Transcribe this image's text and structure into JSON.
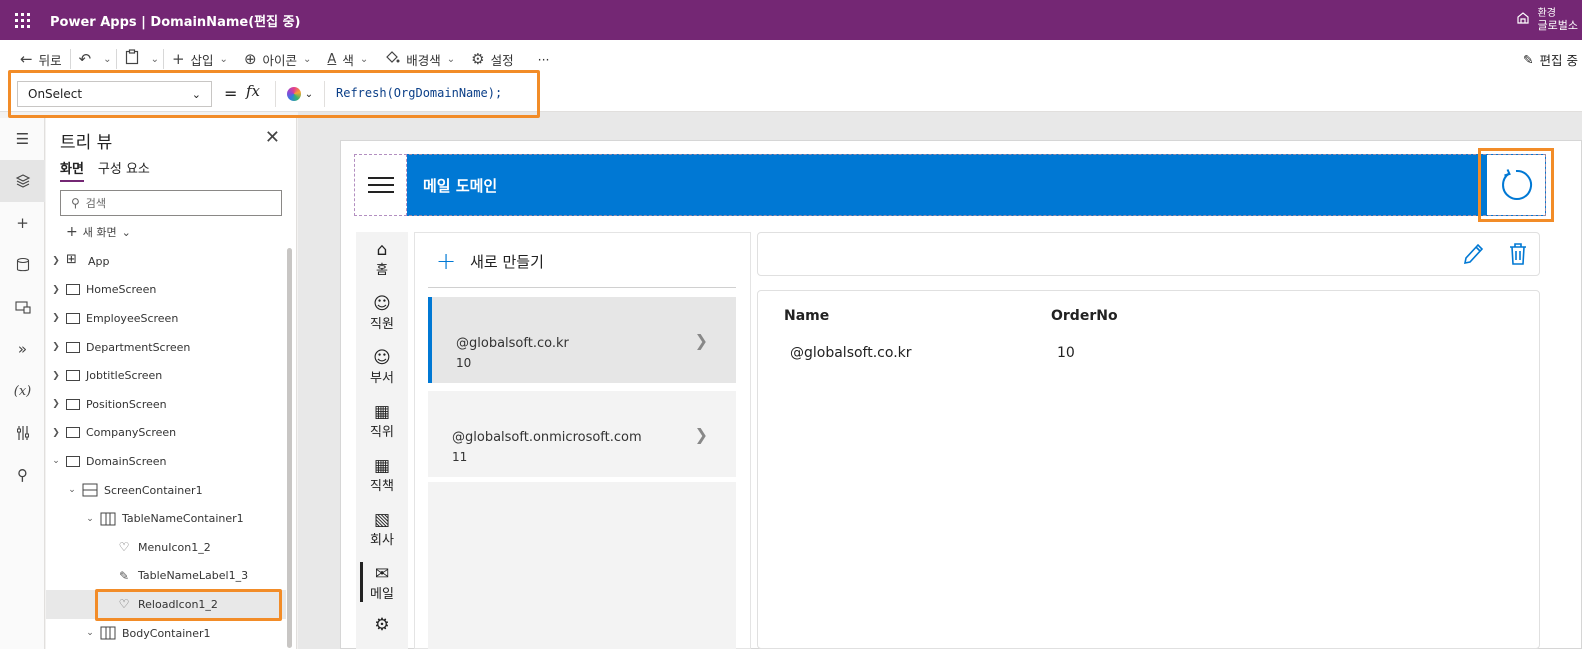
{
  "topbar": {
    "title": "Power Apps  |  DomainName(편집 중)",
    "env_label": "환경",
    "env_name": "글로벌소"
  },
  "commandbar": {
    "back": "뒤로",
    "insert": "삽입",
    "icon": "아이콘",
    "color": "색",
    "background": "배경색",
    "settings": "설정",
    "more": "···",
    "editing": "편집 중"
  },
  "formula": {
    "property": "OnSelect",
    "equals": "=",
    "fx": "fx",
    "expression": "Refresh(OrgDomainName);"
  },
  "tree": {
    "title": "트리 뷰",
    "tabs": [
      "화면",
      "구성 요소"
    ],
    "search_placeholder": "검색",
    "new_screen": "새 화면",
    "nodes": [
      {
        "label": "App"
      },
      {
        "label": "HomeScreen"
      },
      {
        "label": "EmployeeScreen"
      },
      {
        "label": "DepartmentScreen"
      },
      {
        "label": "JobtitleScreen"
      },
      {
        "label": "PositionScreen"
      },
      {
        "label": "CompanyScreen"
      },
      {
        "label": "DomainScreen"
      },
      {
        "label": "ScreenContainer1"
      },
      {
        "label": "TableNameContainer1"
      },
      {
        "label": "MenuIcon1_2"
      },
      {
        "label": "TableNameLabel1_3"
      },
      {
        "label": "ReloadIcon1_2"
      },
      {
        "label": "BodyContainer1"
      }
    ]
  },
  "app": {
    "header_title": "메일 도메인",
    "nav": [
      {
        "label": "홈",
        "icon": "home-icon"
      },
      {
        "label": "직원",
        "icon": "person-icon"
      },
      {
        "label": "부서",
        "icon": "people-icon"
      },
      {
        "label": "직위",
        "icon": "badge-icon"
      },
      {
        "label": "직책",
        "icon": "badge-icon"
      },
      {
        "label": "회사",
        "icon": "building-icon"
      },
      {
        "label": "메일",
        "icon": "mail-icon"
      }
    ],
    "new_button": "새로 만들기",
    "gallery": [
      {
        "name": "@globalsoft.co.kr",
        "order": "10"
      },
      {
        "name": "@globalsoft.onmicrosoft.com",
        "order": "11"
      }
    ],
    "detail": {
      "col_name": "Name",
      "col_order": "OrderNo",
      "name_value": "@globalsoft.co.kr",
      "order_value": "10"
    }
  },
  "colors": {
    "brand_purple": "#742774",
    "accent_blue": "#0078d4",
    "highlight_orange": "#f28c28"
  }
}
